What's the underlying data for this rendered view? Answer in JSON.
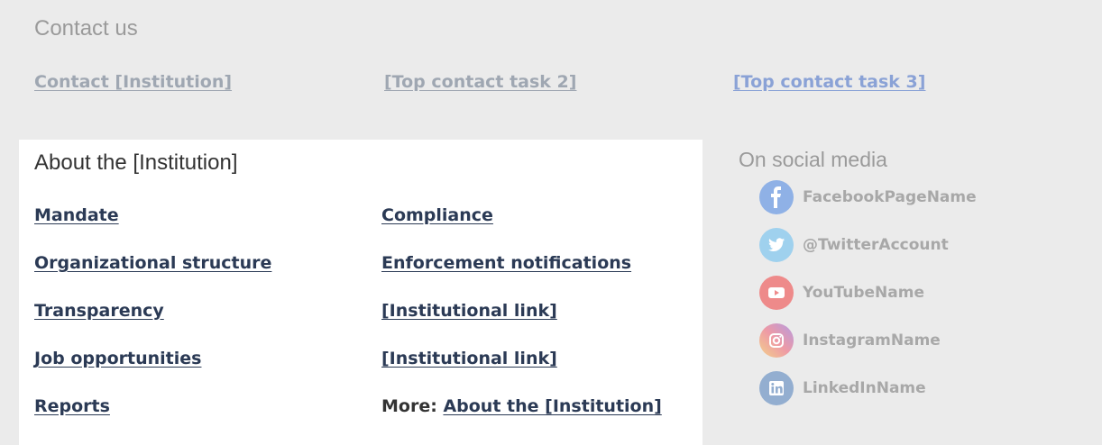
{
  "contact": {
    "title": "Contact us",
    "links": [
      "Contact [Institution]",
      "[Top contact task 2]",
      "[Top contact task 3]"
    ]
  },
  "about": {
    "title": "About the [Institution]",
    "col1": [
      "Mandate",
      "Organizational structure",
      "Transparency",
      "Job opportunities",
      "Reports"
    ],
    "col2": [
      "Compliance",
      "Enforcement notifications",
      "[Institutional link]",
      "[Institutional link]"
    ],
    "more_prefix": "More:",
    "more_link": "About the [Institution]"
  },
  "social": {
    "title": "On social media",
    "items": [
      {
        "label": "FacebookPageName",
        "icon": "facebook-icon",
        "color": "#8fb1e6"
      },
      {
        "label": "@TwitterAccount",
        "icon": "twitter-icon",
        "color": "#9fd1ee"
      },
      {
        "label": "YouTubeName",
        "icon": "youtube-icon",
        "color": "#ee8a8a"
      },
      {
        "label": "InstagramName",
        "icon": "instagram-icon",
        "color": "#d9a7d8"
      },
      {
        "label": "LinkedInName",
        "icon": "linkedin-icon",
        "color": "#93aed0"
      }
    ]
  }
}
